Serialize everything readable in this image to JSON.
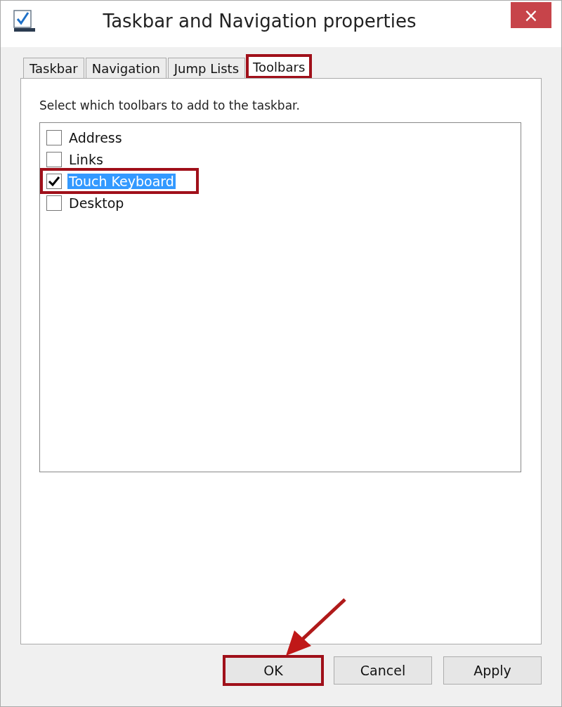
{
  "window": {
    "title": "Taskbar and Navigation properties",
    "close": "×"
  },
  "tabs": [
    {
      "label": "Taskbar",
      "selected": false,
      "highlighted": false
    },
    {
      "label": "Navigation",
      "selected": false,
      "highlighted": false
    },
    {
      "label": "Jump Lists",
      "selected": false,
      "highlighted": false
    },
    {
      "label": "Toolbars",
      "selected": true,
      "highlighted": true
    }
  ],
  "instruction": "Select which toolbars to add to the taskbar.",
  "toolbars": [
    {
      "label": "Address",
      "checked": false,
      "selected": false,
      "highlighted": false
    },
    {
      "label": "Links",
      "checked": false,
      "selected": false,
      "highlighted": false
    },
    {
      "label": "Touch Keyboard",
      "checked": true,
      "selected": true,
      "highlighted": true
    },
    {
      "label": "Desktop",
      "checked": false,
      "selected": false,
      "highlighted": false
    }
  ],
  "buttons": [
    {
      "label": "OK",
      "highlighted": true
    },
    {
      "label": "Cancel",
      "highlighted": false
    },
    {
      "label": "Apply",
      "highlighted": false
    }
  ]
}
